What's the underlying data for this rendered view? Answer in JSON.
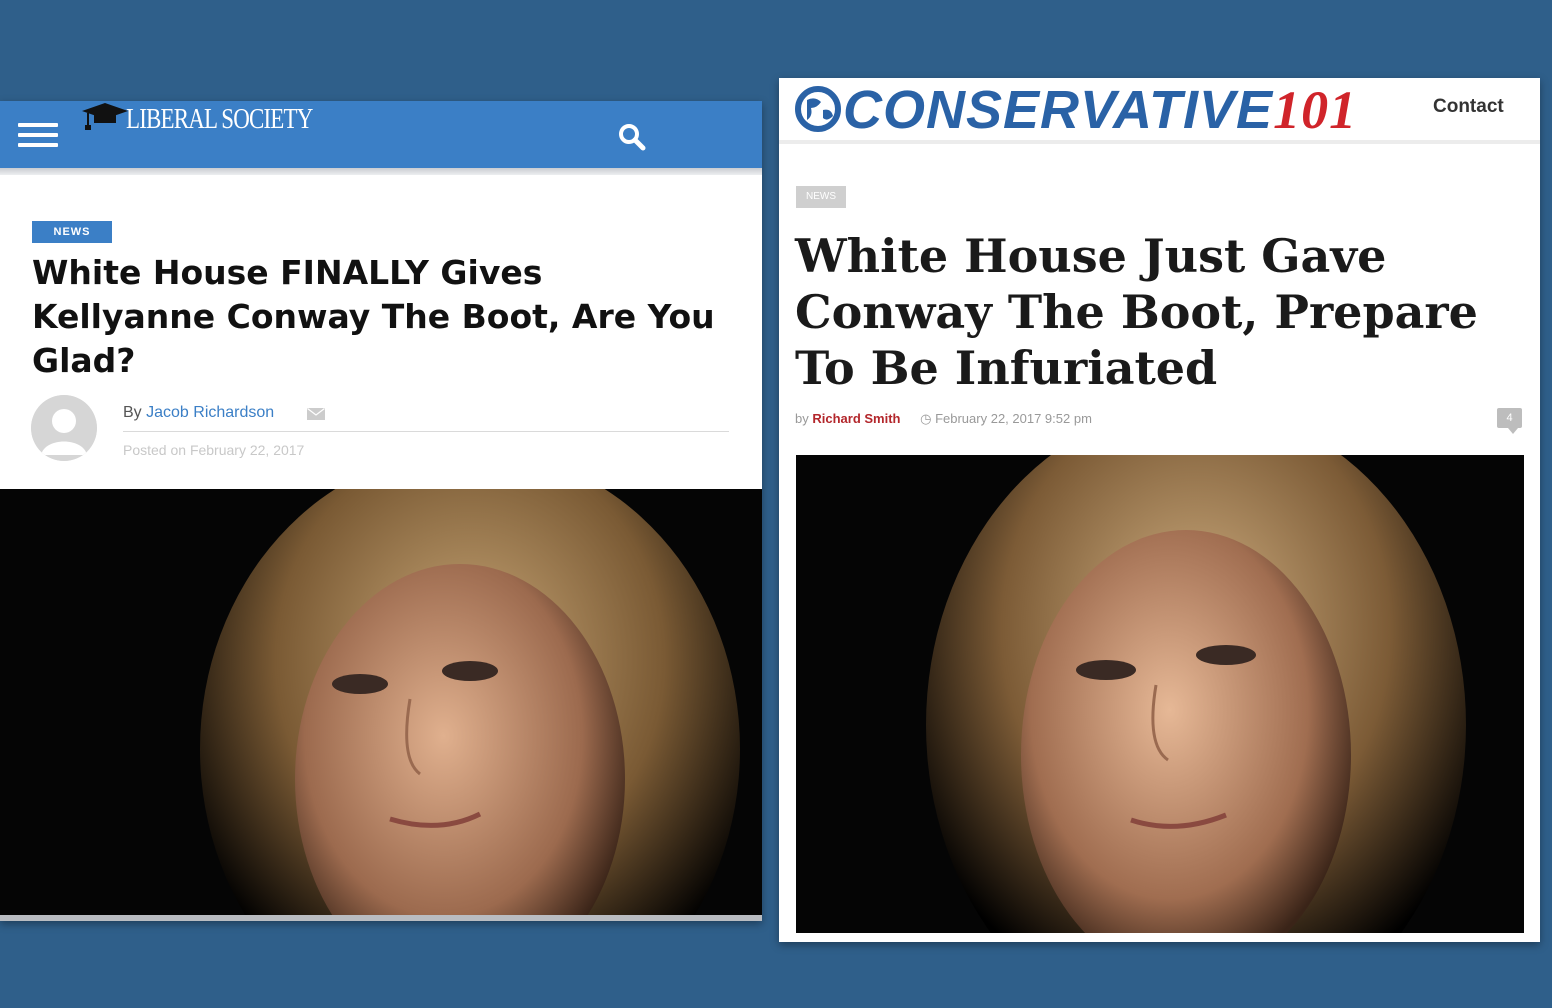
{
  "left_site": {
    "logo_text": "LIBERAL SOCIETY",
    "menu_icon": "hamburger-menu-icon",
    "search_icon": "search-icon",
    "badge": "NEWS",
    "headline": "White House FINALLY Gives Kellyanne Conway The Boot, Are You Glad?",
    "byline_prefix": "By",
    "author": "Jacob Richardson",
    "posted": "Posted on February 22, 2017",
    "accent_color": "#3b7fc6"
  },
  "right_site": {
    "logo_main": "CONSERVATIVE",
    "logo_number": "101",
    "nav_contact": "Contact",
    "badge": "NEWS",
    "headline": "White House Just Gave Conway The Boot, Prepare To Be Infuriated",
    "byline_prefix": "by",
    "author": "Richard Smith",
    "date": "February 22, 2017 9:52 pm",
    "comment_count": "4",
    "brand_blue": "#2a62a6",
    "brand_red": "#d0242a"
  },
  "background_color": "#2f5f8a"
}
